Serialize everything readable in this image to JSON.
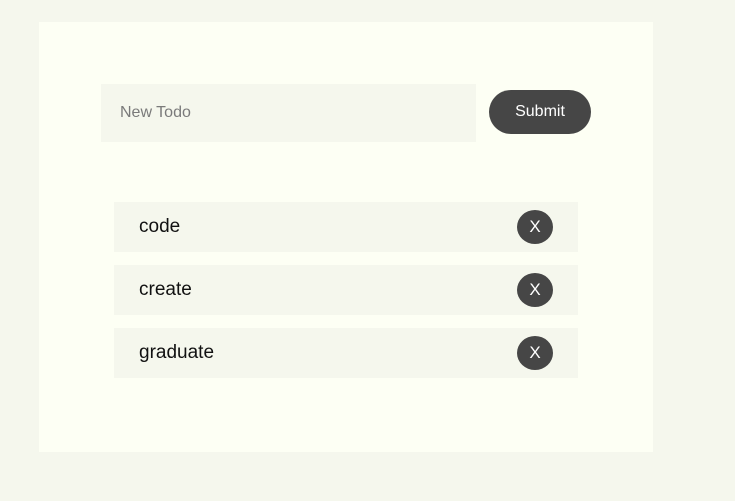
{
  "form": {
    "input_placeholder": "New Todo",
    "input_value": "",
    "submit_label": "Submit"
  },
  "todos": [
    {
      "text": "code",
      "delete_label": "X"
    },
    {
      "text": "create",
      "delete_label": "X"
    },
    {
      "text": "graduate",
      "delete_label": "X"
    }
  ],
  "colors": {
    "page_background": "#f5f7ed",
    "card_background": "#fdfff4",
    "field_background": "#f5f7ed",
    "button_background": "#464646",
    "button_text": "#ffffff"
  }
}
